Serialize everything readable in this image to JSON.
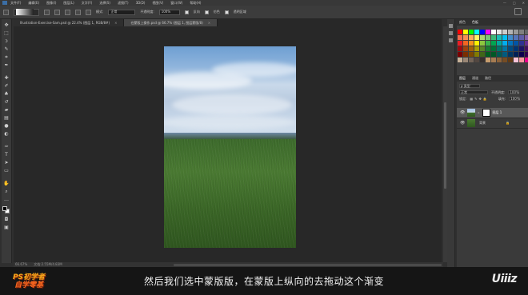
{
  "menubar": {
    "items": [
      "文件(F)",
      "编辑(E)",
      "图像(I)",
      "图层(L)",
      "文字(Y)",
      "选择(S)",
      "滤镜(T)",
      "3D(D)",
      "视图(V)",
      "窗口(W)",
      "帮助(H)"
    ]
  },
  "window_controls": [
    "—",
    "□",
    "✕"
  ],
  "options_bar": {
    "mode_label": "模式:",
    "mode_value": "正常",
    "opacity_label": "不透明度:",
    "opacity_value": "100%",
    "reverse_label": "反向",
    "dither_label": "仿色",
    "transparency_label": "透明区域"
  },
  "tabs": [
    {
      "label": "Illustration-Exercise-Sam.psd @ 22.4% (图层 1, RGB/8#)",
      "active": false
    },
    {
      "label": "在蒙版上操作.psd @ 66.7% (图层 1, 图层蒙版/8)",
      "active": true
    }
  ],
  "status_bar": {
    "zoom": "66.67%",
    "doc": "文档:2.55M/4.83M"
  },
  "color_panel": {
    "tabs": [
      "颜色",
      "色板"
    ],
    "active_tab": "色板"
  },
  "swatch_colors": [
    "#ff0000",
    "#ffff00",
    "#00ff00",
    "#00ffff",
    "#0000ff",
    "#ff00ff",
    "#ffffff",
    "#e6e6e6",
    "#cccccc",
    "#b3b3b3",
    "#999999",
    "#808080",
    "#666666",
    "#4d4d4d",
    "#f26c4f",
    "#f68e56",
    "#fbaf5d",
    "#fff568",
    "#acd373",
    "#7cc576",
    "#3bb878",
    "#1abbb4",
    "#00bff3",
    "#438ccb",
    "#5574b9",
    "#605ca8",
    "#855fa8",
    "#a763a8",
    "#ed1c24",
    "#f26522",
    "#f7941d",
    "#fff200",
    "#8dc73f",
    "#39b54a",
    "#00a651",
    "#00a99d",
    "#00aeef",
    "#0072bc",
    "#0054a6",
    "#2e3192",
    "#662d91",
    "#92278f",
    "#9e0b0f",
    "#a0410d",
    "#a36209",
    "#aba000",
    "#598527",
    "#1a7b30",
    "#007236",
    "#00746b",
    "#0076a3",
    "#004b80",
    "#003471",
    "#1b1464",
    "#440e62",
    "#630460",
    "#790000",
    "#7b2e00",
    "#7d4900",
    "#827b00",
    "#406618",
    "#005e20",
    "#005826",
    "#005952",
    "#005b7f",
    "#003663",
    "#002157",
    "#0d004c",
    "#32004b",
    "#4b0049",
    "#c7b299",
    "#998675",
    "#736357",
    "#534741",
    "#37302d",
    "#c69c6d",
    "#a67c52",
    "#8c6239",
    "#754c24",
    "#603913",
    "#f9c3d7",
    "#f5989d",
    "#ec008c",
    "#ed145b"
  ],
  "layers_panel": {
    "tabs": [
      "图层",
      "通道",
      "路径"
    ],
    "active_tab": "图层",
    "kind_label": "ρ 类型",
    "blend_mode": "正常",
    "opacity_label": "不透明度:",
    "opacity_value": "100%",
    "lock_label": "锁定:",
    "fill_label": "填充:",
    "fill_value": "100%",
    "layers": [
      {
        "name": "图层 1",
        "selected": true
      },
      {
        "name": "背景",
        "selected": false
      }
    ]
  },
  "subtitle": "然后我们选中蒙版版，在蒙版上纵向的去拖动这个渐变",
  "logo_left": {
    "line1": "PS初学者",
    "line2": "自学零基"
  },
  "logo_right": "Uiiiz"
}
